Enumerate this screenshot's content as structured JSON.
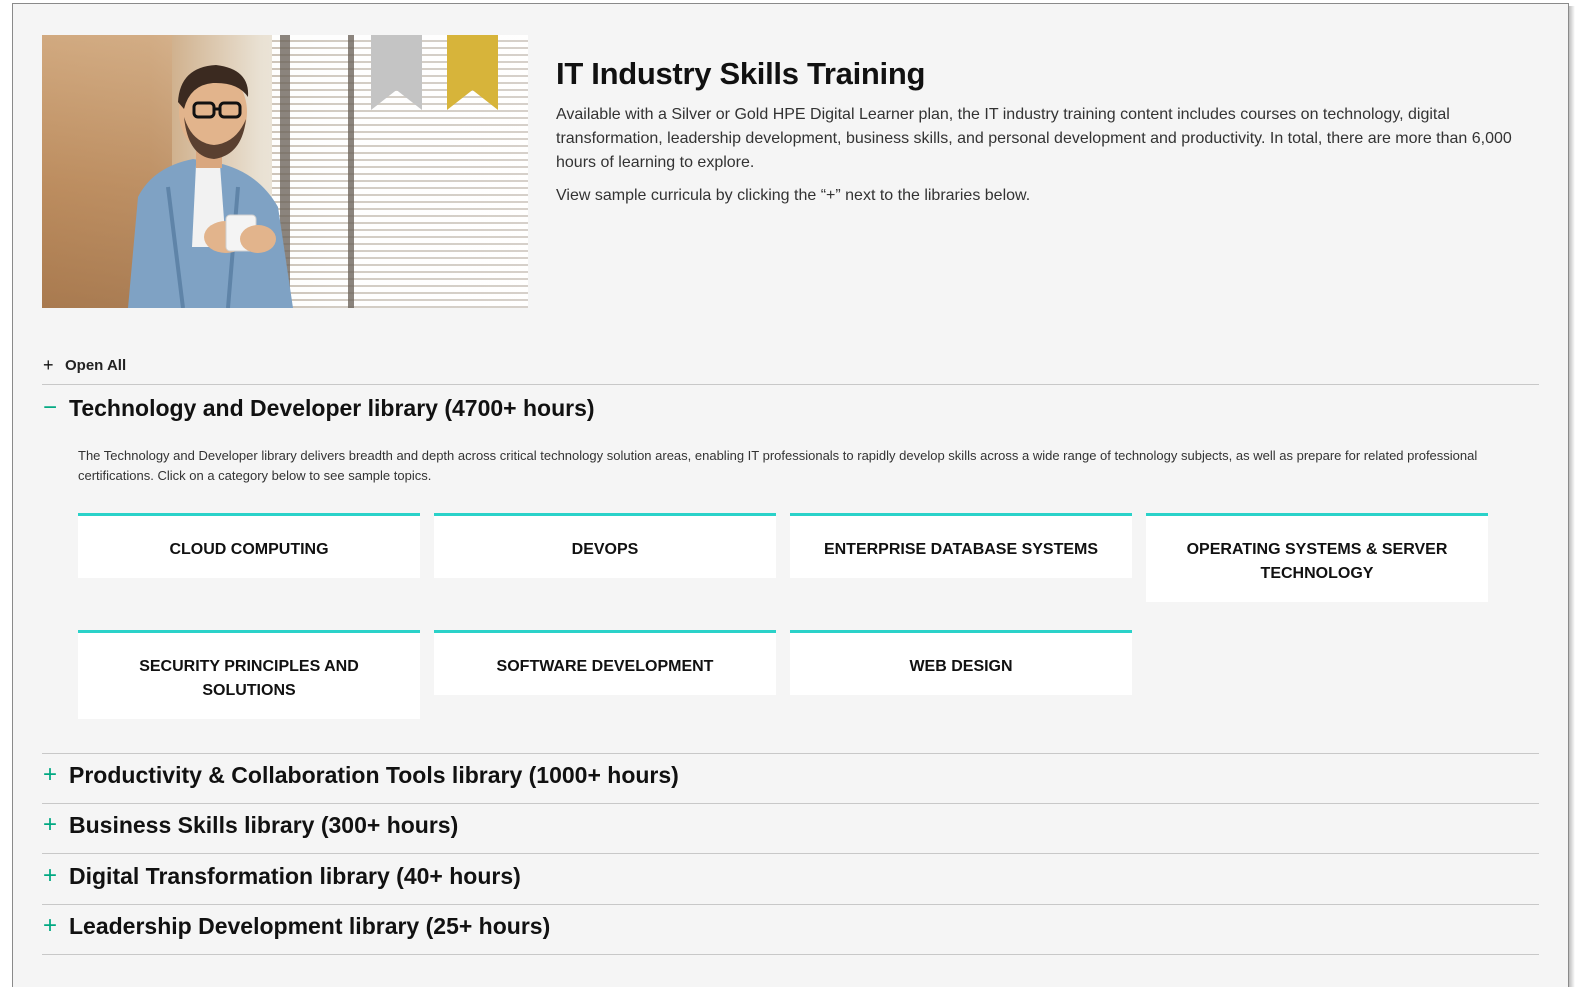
{
  "header": {
    "title": "IT Industry Skills Training",
    "description": "Available with a Silver or Gold HPE Digital Learner plan, the IT industry training content includes courses on technology, digital transformation, leadership development, business skills, and personal development and productivity. In total, there are more than 6,000 hours of learning to explore.",
    "hint": "View sample curricula by clicking the “+” next to the libraries below."
  },
  "open_all": {
    "icon": "+",
    "label": "Open All"
  },
  "libraries": [
    {
      "icon": "−",
      "title": "Technology and Developer library (4700+ hours)",
      "expanded": true,
      "description": "The Technology and Developer library delivers breadth and depth across critical technology solution areas, enabling IT professionals to rapidly develop skills across a wide range of technology subjects, as well as prepare for related professional certifications. Click on a category below to see sample topics.",
      "categories": [
        "CLOUD COMPUTING",
        "DEVOPS",
        "ENTERPRISE DATABASE SYSTEMS",
        "OPERATING SYSTEMS & SERVER TECHNOLOGY",
        "SECURITY PRINCIPLES AND SOLUTIONS",
        "SOFTWARE DEVELOPMENT",
        "WEB DESIGN"
      ]
    },
    {
      "icon": "+",
      "title": "Productivity & Collaboration Tools library (1000+ hours)",
      "expanded": false
    },
    {
      "icon": "+",
      "title": "Business Skills library (300+ hours)",
      "expanded": false
    },
    {
      "icon": "+",
      "title": "Digital Transformation library (40+ hours)",
      "expanded": false
    },
    {
      "icon": "+",
      "title": "Leadership Development library (25+ hours)",
      "expanded": false
    }
  ],
  "colors": {
    "accent_teal": "#2ad2c9",
    "expand_green": "#01a982",
    "ribbon_silver": "#c4c4c4",
    "ribbon_gold": "#d7b43a"
  }
}
